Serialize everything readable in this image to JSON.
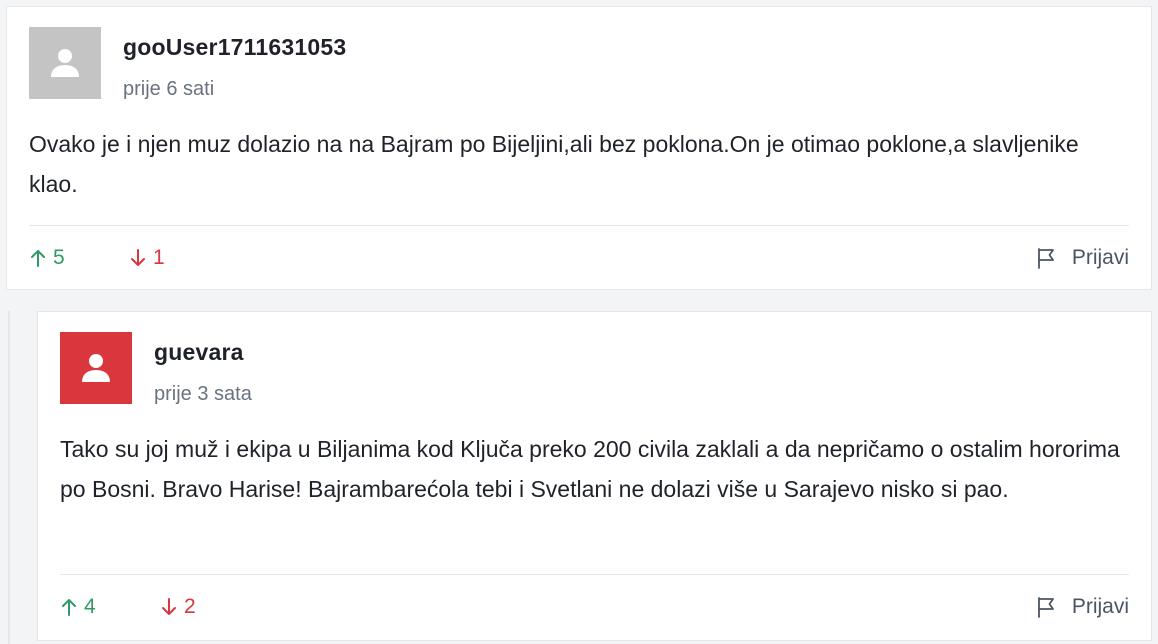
{
  "comments": [
    {
      "username": "gooUser1711631053",
      "time": "prije 6 sati",
      "avatar_color": "#c4c4c4",
      "text": "Ovako je i njen muz dolazio na na Bajram po Bijeljini,ali bez poklona.On je otimao poklone,a slavljenike klao.",
      "upvotes": "5",
      "downvotes": "1",
      "report_label": "Prijavi"
    },
    {
      "username": "guevara",
      "time": "prije 3 sata",
      "avatar_color": "#d9363e",
      "text": "Tako su joj muž i ekipa u Biljanima kod Ključa preko 200 civila zaklali a da nepričamo o ostalim hororima po Bosni. Bravo Harise! Bajrambarećola tebi i Svetlani ne dolazi više u Sarajevo nisko si pao.",
      "upvotes": "4",
      "downvotes": "2",
      "report_label": "Prijavi"
    }
  ],
  "colors": {
    "upvote": "#2f9a64",
    "downvote": "#d9363e",
    "background": "#f3f4f6"
  },
  "icons": {
    "avatar": "user-silhouette-icon",
    "upvote": "arrow-up-icon",
    "downvote": "arrow-down-icon",
    "report": "flag-icon"
  }
}
